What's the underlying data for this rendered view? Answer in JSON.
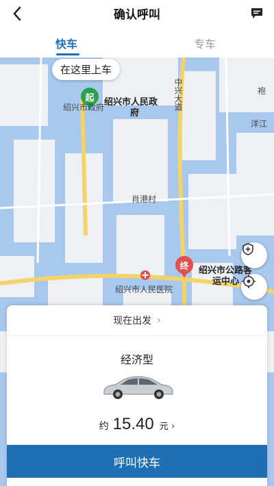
{
  "header": {
    "title": "确认呼叫"
  },
  "tabs": [
    {
      "label": "快车",
      "active": true
    },
    {
      "label": "专车",
      "active": false
    }
  ],
  "map": {
    "pickup_bubble": "在这里上车",
    "start_marker": "起",
    "end_marker": "终",
    "labels": {
      "gov1": "绍兴市人民政",
      "gov2": "府",
      "gov_short": "绍兴市政府",
      "village": "肖港村",
      "road": "中兴大道",
      "hospital": "绍兴市人民医院",
      "station1": "绍兴市公路客",
      "station2": "运中心",
      "pao": "袍",
      "yangjiang": "洋江"
    }
  },
  "panel": {
    "departure": "现在出发",
    "car_type": "经济型",
    "price_prefix": "约",
    "price": "15.40",
    "price_unit": "元"
  },
  "call_button": "呼叫快车",
  "colors": {
    "accent": "#1f6fb5",
    "map_water": "#a9c8ee",
    "start": "#2aa14a",
    "end": "#e24d4d"
  }
}
